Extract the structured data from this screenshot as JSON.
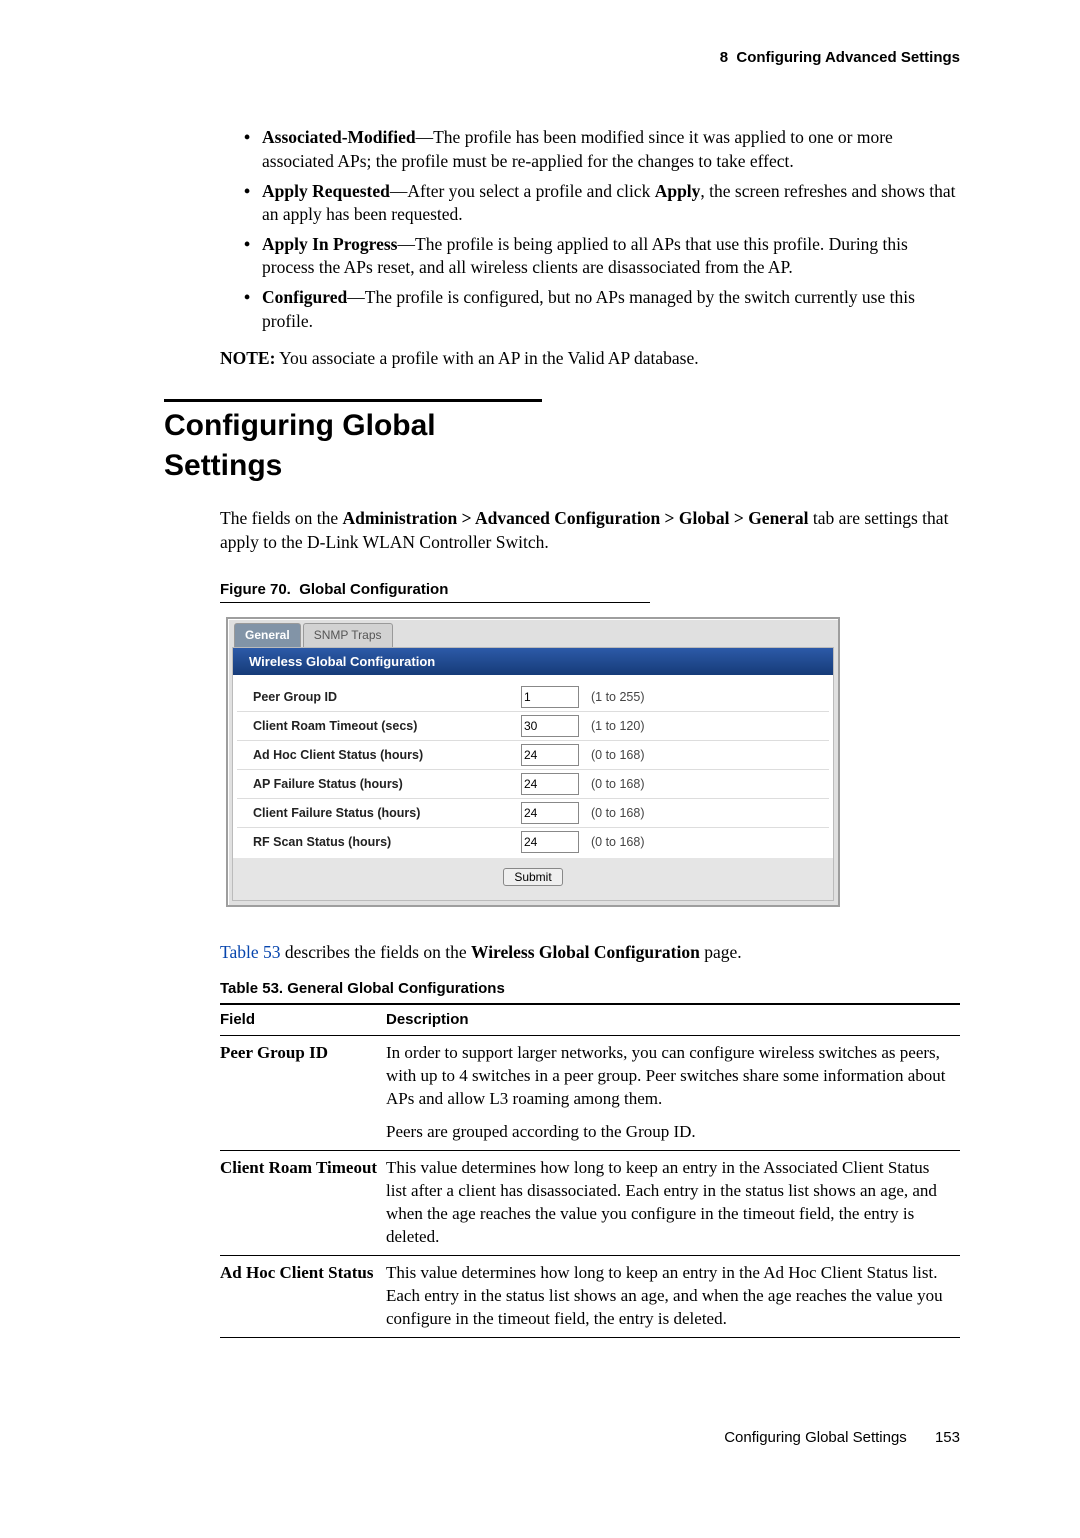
{
  "header": {
    "chapter_num": "8",
    "chapter_title": "Configuring Advanced Settings"
  },
  "bullets": [
    {
      "term": "Associated-Modified",
      "text": "—The profile has been modified since it was applied to one or more associated APs; the profile must be re-applied for the changes to take effect."
    },
    {
      "term": "Apply Requested",
      "text_pre": "—After you select a profile and click ",
      "text_bold": "Apply",
      "text_post": ", the screen refreshes and shows that an apply has been requested."
    },
    {
      "term": "Apply In Progress",
      "text": "—The profile is being applied to all APs that use this profile. During this process the APs reset, and all wireless clients are disassociated from the AP."
    },
    {
      "term": "Configured",
      "text": "—The profile is configured, but no APs managed by the switch currently use this profile."
    }
  ],
  "note": {
    "label": "NOTE:",
    "text": "You associate a profile with an AP in the Valid AP database."
  },
  "section_title": "Configuring Global Settings",
  "intro": {
    "pre": "The fields on the ",
    "path": "Administration > Advanced Configuration > Global > General",
    "post": " tab are settings that apply to the D-Link WLAN Controller Switch."
  },
  "figure": {
    "num": "Figure 70.",
    "title": "Global Configuration"
  },
  "ui": {
    "tabs": [
      "General",
      "SNMP Traps"
    ],
    "title": "Wireless Global Configuration",
    "rows": [
      {
        "label": "Peer Group ID",
        "value": "1",
        "hint": "(1 to 255)"
      },
      {
        "label": "Client Roam Timeout (secs)",
        "value": "30",
        "hint": "(1 to 120)"
      },
      {
        "label": "Ad Hoc Client Status (hours)",
        "value": "24",
        "hint": "(0 to 168)"
      },
      {
        "label": "AP Failure Status (hours)",
        "value": "24",
        "hint": "(0 to 168)"
      },
      {
        "label": "Client Failure Status (hours)",
        "value": "24",
        "hint": "(0 to 168)"
      },
      {
        "label": "RF Scan Status (hours)",
        "value": "24",
        "hint": "(0 to 168)"
      }
    ],
    "submit": "Submit"
  },
  "after_fig": {
    "link": "Table 53",
    "text_post": " describes the fields on the ",
    "bold": "Wireless Global Configuration",
    "tail": " page."
  },
  "table_cap": {
    "num": "Table 53.",
    "title": "General Global Configurations"
  },
  "table": {
    "head": [
      "Field",
      "Description"
    ],
    "rows": [
      {
        "field": "Peer Group ID",
        "desc1": "In order to support larger networks, you can configure wireless switches as peers, with up to 4 switches in a peer group. Peer switches share some information about APs and allow L3 roaming among them.",
        "desc2": "Peers are grouped according to the Group ID."
      },
      {
        "field": "Client Roam Timeout",
        "desc1": "This value determines how long to keep an entry in the Associated Client Status list after a client has disassociated. Each entry in the status list shows an age, and when the age reaches the value you configure in the timeout field, the entry is deleted."
      },
      {
        "field": "Ad Hoc Client Status",
        "desc1": "This value determines how long to keep an entry in the Ad Hoc Client Status list. Each entry in the status list shows an age, and when the age reaches the value you configure in the timeout field, the entry is deleted."
      }
    ]
  },
  "footer": {
    "section": "Configuring Global Settings",
    "page": "153"
  }
}
